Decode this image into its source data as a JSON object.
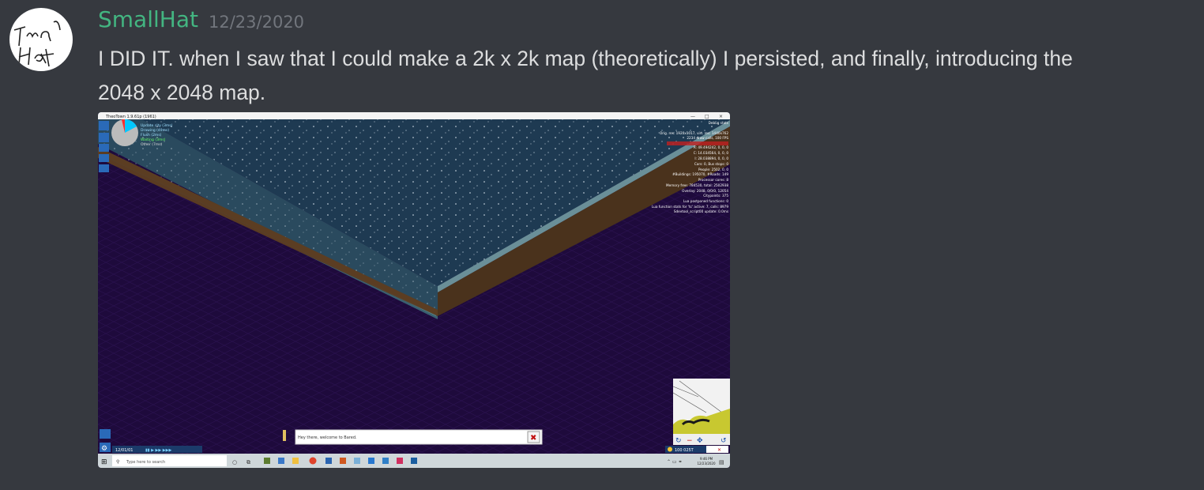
{
  "message": {
    "author": "SmallHat",
    "timestamp": "12/23/2020",
    "text": "I DID IT. when I saw that I could make a 2k x 2k map (theoretically) I persisted, and finally, introducing the 2048 x 2048 map.",
    "avatar_icon": "handwritten-smallhat-avatar",
    "author_color": "#43b581"
  },
  "attachment": {
    "window_title": "TheoTown 1.9.61p (1961)",
    "notification_text": "Hey there, welcome to Bared.",
    "taskbar_search_placeholder": "Type here to search",
    "taskbar_time": "9:46 PM",
    "taskbar_date": "12/23/2020",
    "game_date": "12/01/01",
    "money": "100 025T",
    "debug_lines": [
      "Update city (3ms)",
      "Drawing (49ms)",
      "Flush (2ms)",
      "Waiting (3ms)",
      "Other (7ms)"
    ],
    "overlay_lines": [
      "Debug stats",
      "Orig. res: 1920x1017, virt. res: 1440x762",
      "2234 draw calls, 100 FPS",
      "R: 49.494242, 0, 0, 0",
      "C: 14.034564, 0, 0, 0",
      "I: 28.038894, 0, 0, 0",
      "Cars: 0, Bus stops: 0",
      "People: 2502, 0, 0",
      "#Buildings: 195070, #Roads: 149",
      "Processor cores: 8",
      "Memory free: 784530, total: 2502938",
      "Overlay: 2048, 0/0/0, 12054",
      "Citypoints: 375",
      "Lua postponed functions: 0",
      "Lua function stats for 'tc' active: 7, calls: 8979",
      "Sdevtool_script00 update: 0.0ms"
    ]
  }
}
